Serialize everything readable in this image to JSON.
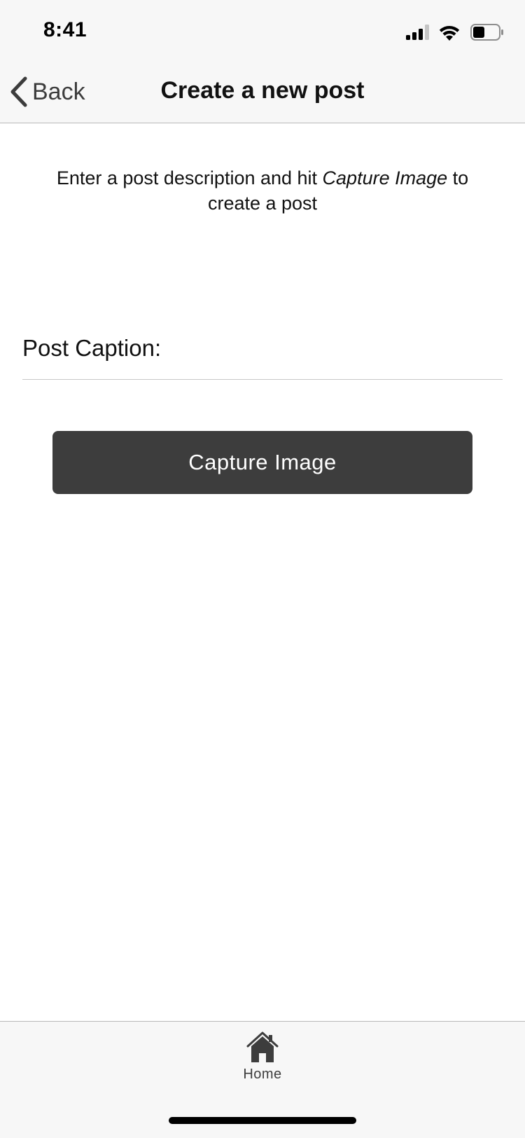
{
  "status_bar": {
    "time": "8:41",
    "icons": [
      "signal-icon",
      "wifi-icon",
      "battery-icon"
    ]
  },
  "nav": {
    "back_label": "Back",
    "back_icon": "chevron-left-icon",
    "title": "Create a new post"
  },
  "content": {
    "instructions_before": "Enter a post description and hit ",
    "instructions_emphasis": "Capture Image",
    "instructions_after": " to create a post",
    "caption_label": "Post Caption:",
    "caption_value": "",
    "capture_button_label": "Capture Image"
  },
  "tab_bar": {
    "items": [
      {
        "label": "Home",
        "icon": "home-icon"
      }
    ]
  },
  "colors": {
    "chrome_background": "#f7f7f7",
    "button_background": "#3d3d3d",
    "button_text": "#ffffff",
    "tab_icon": "#3d3d3d"
  }
}
